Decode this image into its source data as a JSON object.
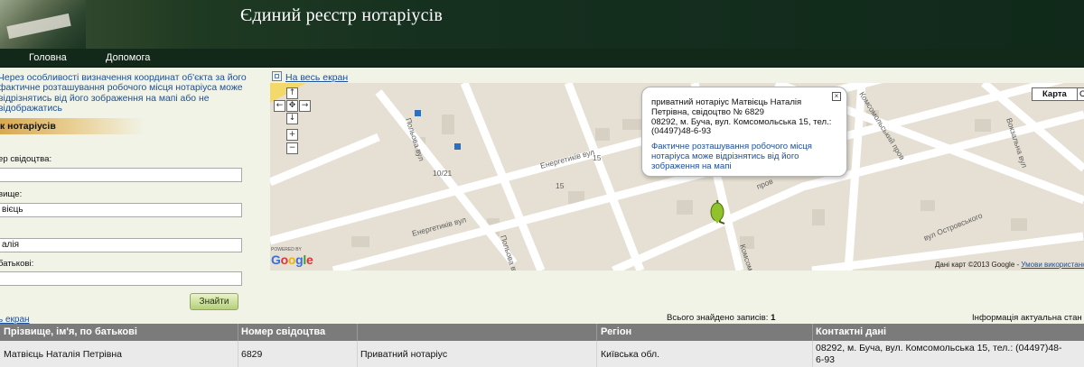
{
  "header": {
    "title": "Єдиний реєстр нотаріусів"
  },
  "nav": {
    "items": [
      "Головна",
      "Допомога"
    ]
  },
  "notice": "Через особливості визначення координат об'єкта за його фактичне розташування робочого місця нотаріуса може відрізнятись від його зображення на мапі або не відображатись",
  "search_panel": {
    "title": "к нотаріусів",
    "fields": [
      {
        "label": "ер свідоцтва:",
        "value": ""
      },
      {
        "label": "вище:",
        "value": "вієць"
      },
      {
        "label": "",
        "value": "алія"
      },
      {
        "label": "батькові:",
        "value": ""
      }
    ],
    "submit_label": "Знайти",
    "fullscreen_link": "ь екран"
  },
  "map": {
    "fullscreen_label": "На весь екран",
    "type_button": "Карта",
    "type_button2": "С",
    "streets": [
      "Польова вул",
      "Енергетиків вул",
      "Енергетиків вул",
      "Польова вул",
      "Комсомольська вул",
      "Комсомольський пров",
      "Вокзальна вул",
      "вул Островського",
      "пров",
      "10/21",
      "15",
      "15"
    ],
    "popup": {
      "line1": "приватний нотаріус Матвієць Наталія Петрівна, свідоцтво № 6829",
      "line2": "08292, м. Буча, вул. Комсомольська 15, тел.: (04497)48-6-93",
      "note": "Фактичне розташування робочого місця нотаріуса може відрізнятись від його зображення на мапі"
    },
    "credit": "Дані карт ©2013 Google - ",
    "credit_link": "Умови використання",
    "google_powered": "POWERED BY",
    "google_logo": "Google"
  },
  "results": {
    "count_label": "Всього знайдено записів:",
    "count": "1",
    "info": "Інформація актуальна стан",
    "columns": [
      "Прізвище, ім'я, по батькові",
      "Номер свідоцтва",
      "Регіон",
      "Контактні дані"
    ],
    "rows": [
      {
        "name": "Матвієць Наталія Петрівна",
        "cert": "6829",
        "type": "Приватний нотаріус",
        "region": "Київська обл.",
        "contact1": "08292, м. Буча, вул. Комсомольська 15, тел.: (04497)48-",
        "contact2": "6-93"
      }
    ]
  },
  "colors": {
    "header_bg": "#163020",
    "link": "#1b4f9a",
    "table_header_bg": "#7b7b7b",
    "panel_accent": "#d9a84f"
  }
}
